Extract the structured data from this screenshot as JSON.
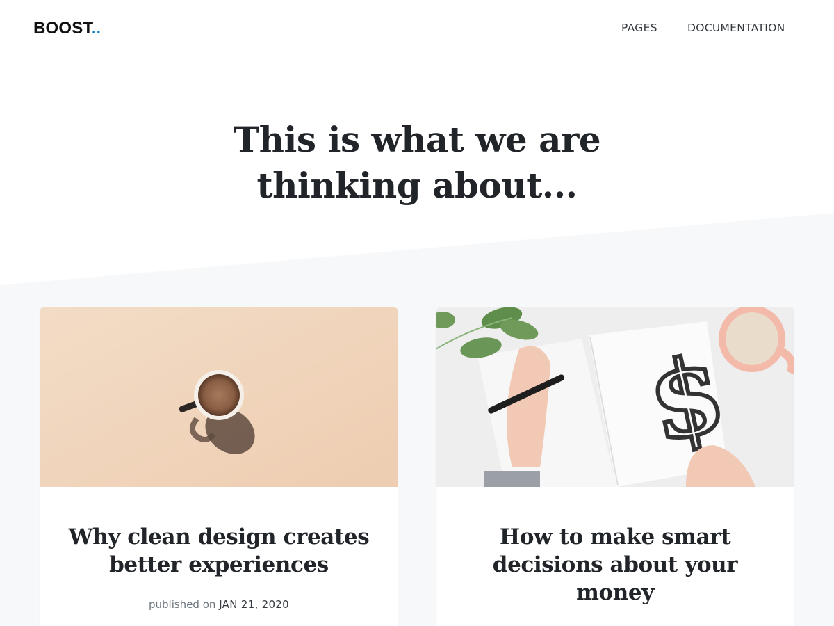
{
  "brand": {
    "name": "BOOST",
    "dots": ".."
  },
  "nav": {
    "pages": "PAGES",
    "documentation": "DOCUMENTATION"
  },
  "hero": {
    "title": "This is what we are thinking about..."
  },
  "colors": {
    "accent": "#1b7fc4",
    "section_bg": "#f6f8fa",
    "coffee_bg": "#f0d2b8"
  },
  "posts": [
    {
      "title": "Why clean design creates better experiences",
      "meta_prefix": "published on",
      "date": "JAN 21, 2020",
      "image": "coffee-cup-image"
    },
    {
      "title": "How to make smart decisions about your money",
      "image": "dollar-sketch-image"
    }
  ]
}
